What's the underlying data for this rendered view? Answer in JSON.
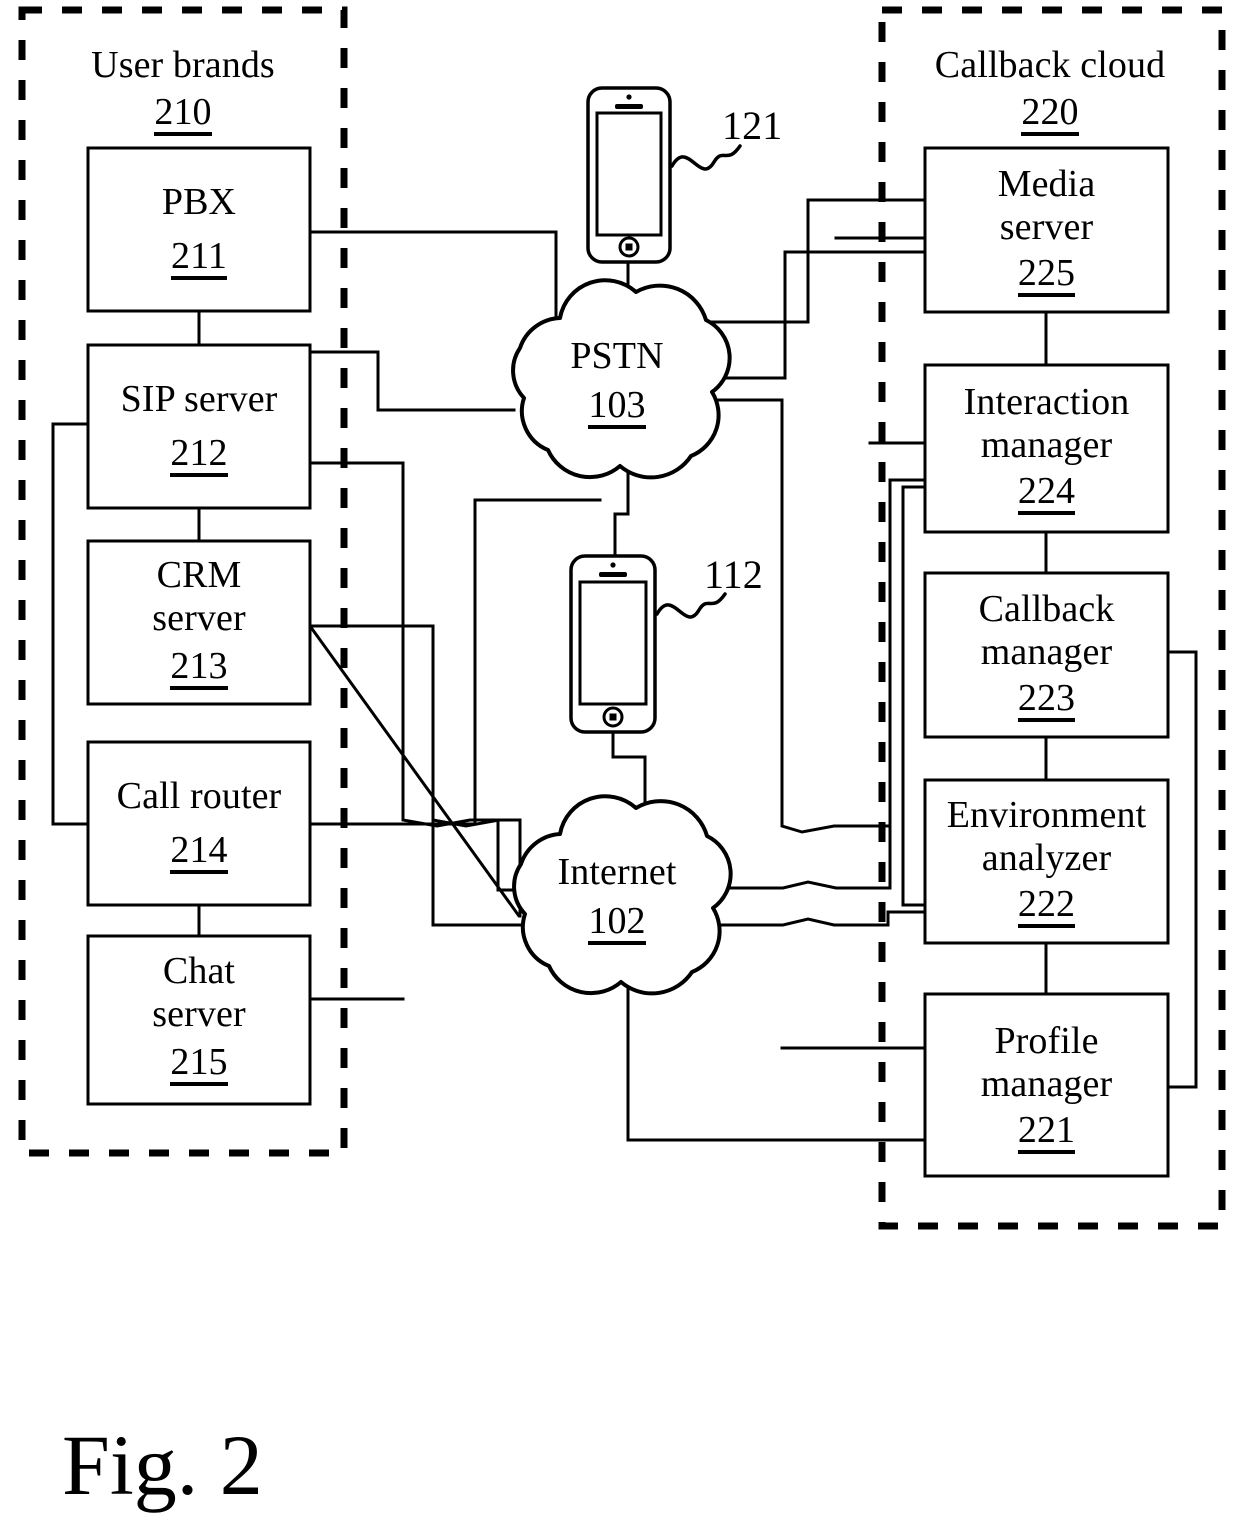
{
  "figure": {
    "caption": "Fig. 2"
  },
  "groups": [
    {
      "id": "user-brands",
      "label": "User brands",
      "ref": "210"
    },
    {
      "id": "callback-cloud",
      "label": "Callback cloud",
      "ref": "220"
    }
  ],
  "left_boxes": [
    {
      "id": "pbx",
      "line1": "PBX",
      "line2": "",
      "ref": "211"
    },
    {
      "id": "sip-server",
      "line1": "SIP server",
      "line2": "",
      "ref": "212"
    },
    {
      "id": "crm-server",
      "line1": "CRM",
      "line2": "server",
      "ref": "213"
    },
    {
      "id": "call-router",
      "line1": "Call router",
      "line2": "",
      "ref": "214"
    },
    {
      "id": "chat-server",
      "line1": "Chat",
      "line2": "server",
      "ref": "215"
    }
  ],
  "right_boxes": [
    {
      "id": "media-server",
      "line1": "Media",
      "line2": "server",
      "ref": "225"
    },
    {
      "id": "interaction-manager",
      "line1": "Interaction",
      "line2": "manager",
      "ref": "224"
    },
    {
      "id": "callback-manager",
      "line1": "Callback",
      "line2": "manager",
      "ref": "223"
    },
    {
      "id": "environment-analyzer",
      "line1": "Environment",
      "line2": "analyzer",
      "ref": "222"
    },
    {
      "id": "profile-manager",
      "line1": "Profile",
      "line2": "manager",
      "ref": "221"
    }
  ],
  "clouds": [
    {
      "id": "pstn",
      "label": "PSTN",
      "ref": "103"
    },
    {
      "id": "internet",
      "label": "Internet",
      "ref": "102"
    }
  ],
  "devices": [
    {
      "id": "phone-upper",
      "type": "smartphone",
      "callout": "121"
    },
    {
      "id": "phone-lower",
      "type": "smartphone",
      "callout": "112"
    }
  ],
  "colors": {
    "line": "#000000",
    "background": "#ffffff"
  }
}
